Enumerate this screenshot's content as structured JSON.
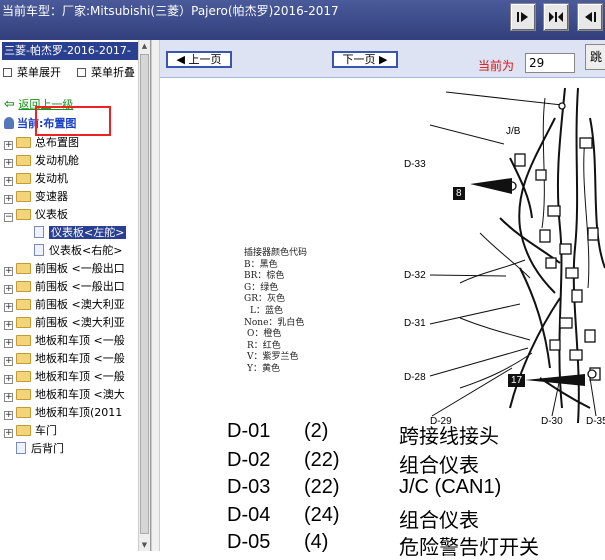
{
  "window": {
    "title": "当前车型：厂家:Mitsubishi(三菱）Pajero(帕杰罗)2016-2017",
    "nav_buttons": [
      "step-forward-icon",
      "expand-icon",
      "step-back-icon"
    ]
  },
  "sidebar": {
    "title": "三菱-帕杰罗-2016-2017-",
    "expand_all": "菜单展开",
    "collapse_all": "菜单折叠",
    "back_link": "返回上一级",
    "current": "当前:布置图",
    "tree": [
      {
        "label": "总布置图",
        "expanded": false
      },
      {
        "label": "发动机舱",
        "expanded": false
      },
      {
        "label": "发动机",
        "expanded": false
      },
      {
        "label": "变速器",
        "expanded": false
      },
      {
        "label": "仪表板",
        "expanded": true,
        "children": [
          {
            "label": "仪表板<左舵>",
            "selected": true
          },
          {
            "label": "仪表板<右舵>",
            "selected": false
          }
        ]
      },
      {
        "label": "前围板 <一般出口",
        "expanded": false
      },
      {
        "label": "前围板 <一般出口",
        "expanded": false
      },
      {
        "label": "前围板 <澳大利亚",
        "expanded": false
      },
      {
        "label": "前围板 <澳大利亚",
        "expanded": false
      },
      {
        "label": "地板和车顶 <一般",
        "expanded": false
      },
      {
        "label": "地板和车顶 <一般",
        "expanded": false
      },
      {
        "label": "地板和车顶 <一般",
        "expanded": false
      },
      {
        "label": "地板和车顶 <澳大",
        "expanded": false
      },
      {
        "label": "地板和车顶(2011",
        "expanded": false
      },
      {
        "label": "车门",
        "expanded": false
      },
      {
        "label": "后背门",
        "leaf": true
      }
    ]
  },
  "toolbar": {
    "prev_page": "上一页",
    "next_page": "下一页",
    "current_page_label": "当前为",
    "current_page": "29",
    "jump_label": "跳"
  },
  "diagram": {
    "connector_labels": [
      "J/B",
      "D-33",
      "D-32",
      "D-31",
      "D-28",
      "D-29",
      "D-30",
      "D-35"
    ],
    "callouts": [
      "8",
      "17"
    ],
    "legend": {
      "title": "插接器颜色代码",
      "entries": [
        "B：黑色",
        "BR：棕色",
        "G：绿色",
        "GR：灰色",
        "L：蓝色",
        "None：乳白色",
        "O：橙色",
        "R：红色",
        "V：紫罗兰色",
        "Y：黄色"
      ]
    },
    "connectors": [
      {
        "code": "D-01",
        "pins": "(2)",
        "name": "跨接线接头"
      },
      {
        "code": "D-02",
        "pins": "(22)",
        "name": "组合仪表"
      },
      {
        "code": "D-03",
        "pins": "(22)",
        "name": "J/C (CAN1)"
      },
      {
        "code": "D-04",
        "pins": "(24)",
        "name": "组合仪表"
      },
      {
        "code": "D-05",
        "pins": "(4)",
        "name": "危险警告灯开关"
      }
    ]
  }
}
